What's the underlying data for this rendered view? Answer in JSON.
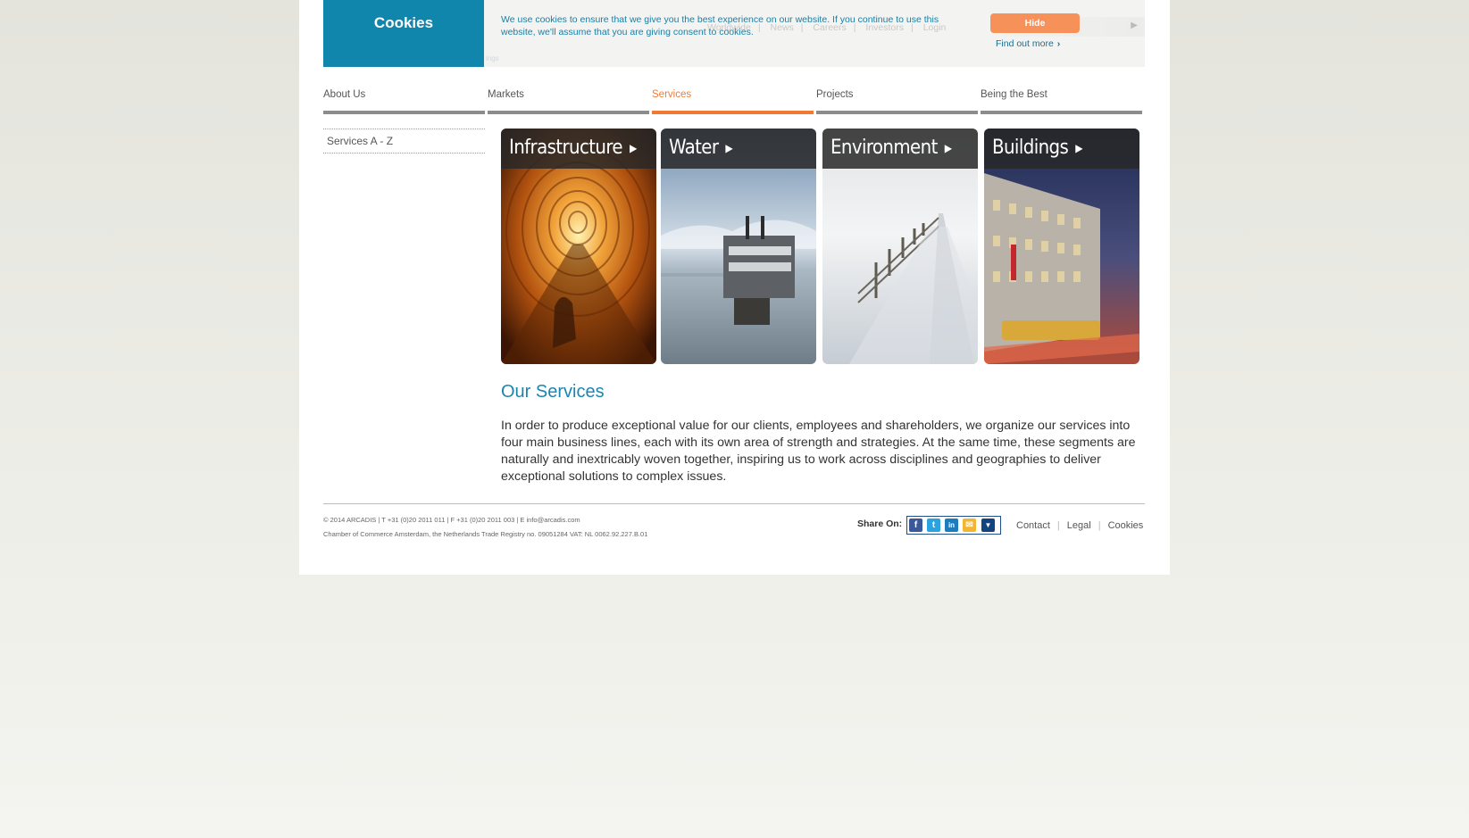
{
  "cookie_bar": {
    "title": "Cookies",
    "message": "We use cookies to ensure that we give you the best experience on our website. If you continue to use this website, we'll assume that you are giving consent to cookies.",
    "hide_label": "Hide",
    "find_out_more": "Find out more",
    "ghost_links": [
      "Worldwide",
      "News",
      "Careers",
      "Investors",
      "Login"
    ],
    "ghost_sub": "ings"
  },
  "nav": {
    "items": [
      {
        "label": "About Us"
      },
      {
        "label": "Markets"
      },
      {
        "label": "Services"
      },
      {
        "label": "Projects"
      },
      {
        "label": "Being the Best"
      }
    ],
    "active": "Services"
  },
  "side_nav": {
    "items": [
      {
        "label": "Services A - Z"
      }
    ]
  },
  "tiles": [
    {
      "label": "Infrastructure"
    },
    {
      "label": "Water"
    },
    {
      "label": "Environment"
    },
    {
      "label": "Buildings"
    }
  ],
  "main": {
    "heading": "Our Services",
    "body": "In order to produce exceptional value for our clients, employees and shareholders, we organize our services into four main business lines, each with its own area of strength and strategies. At the same time, these segments are naturally and inextricably woven together, inspiring us to work across disciplines and geographies to deliver exceptional solutions to complex issues."
  },
  "footer": {
    "copyright": "© 2014 ARCADIS | T +31 (0)20 2011 011 | F +31 (0)20 2011 003  | E info@arcadis.com",
    "chamber": "Chamber of Commerce Amsterdam, the Netherlands Trade Registry no. 09051284 VAT: NL 0062.92.227.B.01",
    "share_label": "Share On:",
    "share_icons": [
      "facebook-icon",
      "twitter-icon",
      "linkedin-icon",
      "email-icon",
      "more-dropdown-icon"
    ],
    "links": [
      "Contact",
      "Legal",
      "Cookies"
    ]
  },
  "colors": {
    "brand_blue": "#1186ad",
    "accent_orange": "#f07a33",
    "hide_button": "#f7915a"
  }
}
